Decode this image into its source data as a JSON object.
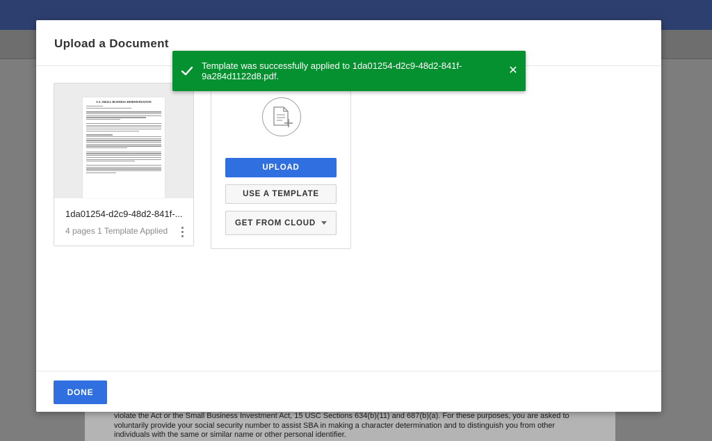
{
  "modal": {
    "title": "Upload a Document",
    "done_label": "DONE"
  },
  "toast": {
    "message": "Template was successfully applied to 1da01254-d2c9-48d2-841f-9a284d1122d8.pdf.",
    "close_icon": "close-icon",
    "status_icon": "checkmark-icon",
    "color": "#05912f"
  },
  "document_card": {
    "name": "1da01254-d2c9-48d2-841f-...",
    "meta": "4 pages 1 Template Applied",
    "thumbnail_title": "U.S. SMALL BUSINESS ADMINISTRATION",
    "menu_icon": "more-vertical-icon"
  },
  "upload_card": {
    "icon": "add-document-icon",
    "upload_label": "UPLOAD",
    "template_label": "USE A TEMPLATE",
    "cloud_label": "GET FROM CLOUD"
  },
  "background_document": {
    "text": "violate the Act or the Small Business Investment Act, 15 USC Sections 634(b)(11) and 687(b)(a). For these purposes, you are asked to voluntarily provide your social security number to assist SBA in making a character determination and to distinguish you from other individuals with the same or similar name or other personal identifier."
  },
  "colors": {
    "primary": "#2f6fe0",
    "header_bar": "#2d3f6e",
    "success": "#05912f"
  }
}
